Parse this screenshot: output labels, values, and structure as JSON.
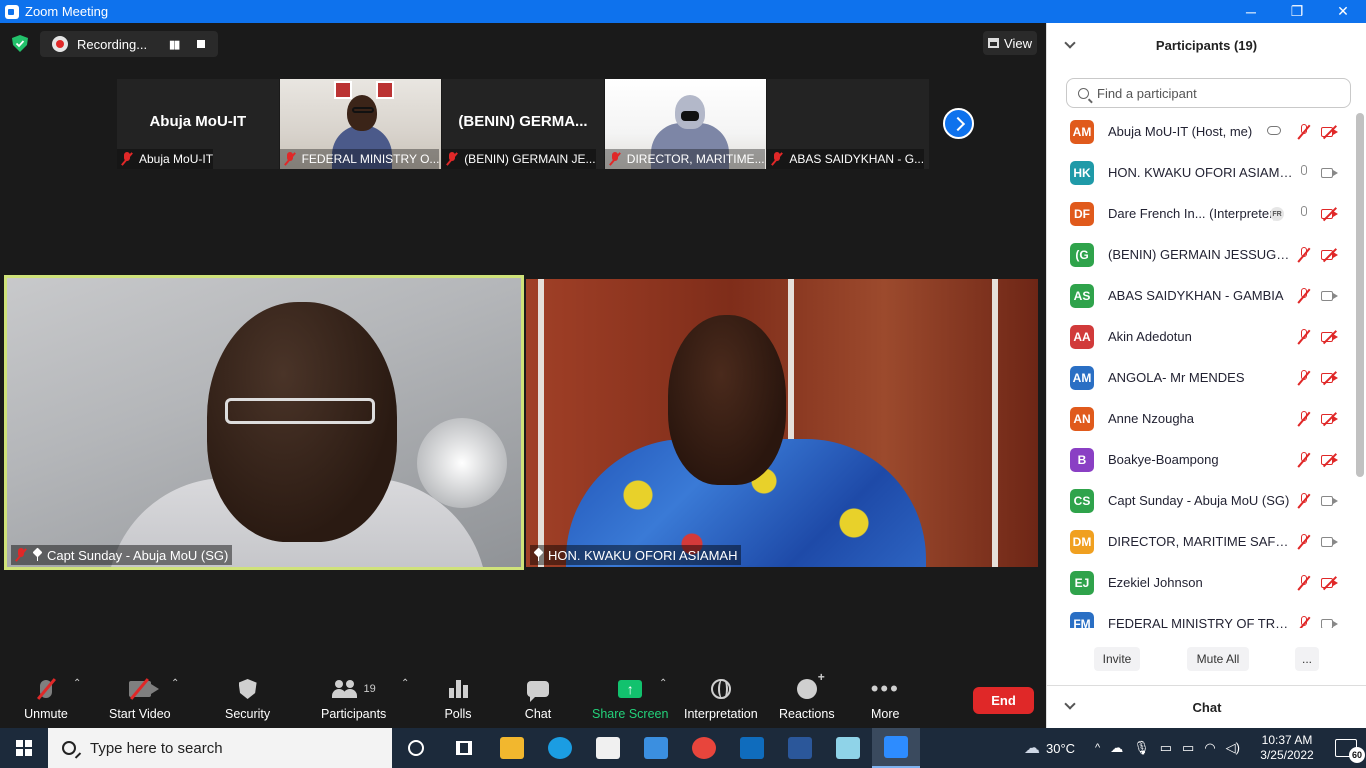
{
  "window": {
    "title": "Zoom Meeting",
    "minimize": "─",
    "restore": "❐",
    "close": "✕"
  },
  "recording": {
    "label": "Recording...",
    "pause": "▮▮"
  },
  "view_button": {
    "label": "View"
  },
  "thumbnails": [
    {
      "big_name": "Abuja MoU-IT",
      "caption": "Abuja MoU-IT"
    },
    {
      "big_name": "",
      "caption": "FEDERAL MINISTRY O..."
    },
    {
      "big_name": "(BENIN) GERMA...",
      "caption": "(BENIN) GERMAIN JE..."
    },
    {
      "big_name": "",
      "caption": "DIRECTOR, MARITIME..."
    },
    {
      "big_name": "",
      "caption": "ABAS SAIDYKHAN - G..."
    }
  ],
  "videos": {
    "active_speaker": {
      "caption": "Capt Sunday - Abuja MoU (SG)"
    },
    "second": {
      "caption": "HON. KWAKU OFORI ASIAMAH"
    }
  },
  "toolbar": {
    "unmute": "Unmute",
    "start_video": "Start Video",
    "security": "Security",
    "participants": "Participants",
    "participants_count": "19",
    "polls": "Polls",
    "chat": "Chat",
    "share_screen": "Share Screen",
    "interpretation": "Interpretation",
    "reactions": "Reactions",
    "more": "More",
    "end": "End",
    "caret": "⌃",
    "share_arrow": "↑",
    "more_dots": "•••"
  },
  "participants_panel": {
    "title": "Participants (19)",
    "search_placeholder": "Find a participant",
    "list": [
      {
        "initials": "AM",
        "color": "#e05a1c",
        "name": "Abuja MoU-IT (Host, me)",
        "mic_off": true,
        "cam_off": true,
        "cloud": true
      },
      {
        "initials": "HK",
        "color": "#1f9aa8",
        "name": "HON. KWAKU OFORI ASIAMAH",
        "mic_off": false,
        "cam_off": false
      },
      {
        "initials": "DF",
        "color": "#e05a1c",
        "name": "Dare French In... (Interpreter)",
        "mic_off": false,
        "cam_off": true,
        "badge": "FR"
      },
      {
        "initials": "(G",
        "color": "#2fa34b",
        "name": "(BENIN) GERMAIN JESSUGNO...",
        "mic_off": true,
        "cam_off": true
      },
      {
        "initials": "AS",
        "color": "#2fa34b",
        "name": "ABAS SAIDYKHAN - GAMBIA",
        "mic_off": true,
        "cam_off": false
      },
      {
        "initials": "AA",
        "color": "#d13a3a",
        "name": "Akin Adedotun",
        "mic_off": true,
        "cam_off": true
      },
      {
        "initials": "AM",
        "color": "#2a6fc4",
        "name": "ANGOLA- Mr MENDES",
        "mic_off": true,
        "cam_off": true
      },
      {
        "initials": "AN",
        "color": "#e05a1c",
        "name": "Anne Nzougha",
        "mic_off": true,
        "cam_off": true
      },
      {
        "initials": "B",
        "color": "#8a3fc4",
        "name": "Boakye-Boampong",
        "mic_off": true,
        "cam_off": true
      },
      {
        "initials": "CS",
        "color": "#2fa34b",
        "name": "Capt Sunday - Abuja MoU (SG)",
        "mic_off": true,
        "cam_off": false
      },
      {
        "initials": "DM",
        "color": "#f0a020",
        "name": "DIRECTOR, MARITIME SAFETY ...",
        "mic_off": true,
        "cam_off": false
      },
      {
        "initials": "EJ",
        "color": "#2fa34b",
        "name": "Ezekiel Johnson",
        "mic_off": true,
        "cam_off": true
      },
      {
        "initials": "FM",
        "color": "#2a6fc4",
        "name": "FEDERAL MINISTRY OF TRANS...",
        "mic_off": true,
        "cam_off": false
      }
    ],
    "invite": "Invite",
    "mute_all": "Mute All",
    "more": "..."
  },
  "chat_panel": {
    "title": "Chat"
  },
  "taskbar": {
    "search_placeholder": "Type here to search",
    "weather": "30°C",
    "time": "10:37 AM",
    "date": "3/25/2022",
    "notifications": "60",
    "apps": [
      {
        "name": "file-explorer",
        "color": "#f2b72e"
      },
      {
        "name": "edge",
        "color": "#1b9de2"
      },
      {
        "name": "store",
        "color": "#f0f0f0"
      },
      {
        "name": "mail",
        "color": "#3b8fe0"
      },
      {
        "name": "chrome",
        "color": "#e8453c"
      },
      {
        "name": "outlook",
        "color": "#0f6cbd"
      },
      {
        "name": "word",
        "color": "#2b579a"
      },
      {
        "name": "notepad",
        "color": "#8fd3e8"
      },
      {
        "name": "zoom",
        "color": "#2d8cff"
      }
    ]
  }
}
